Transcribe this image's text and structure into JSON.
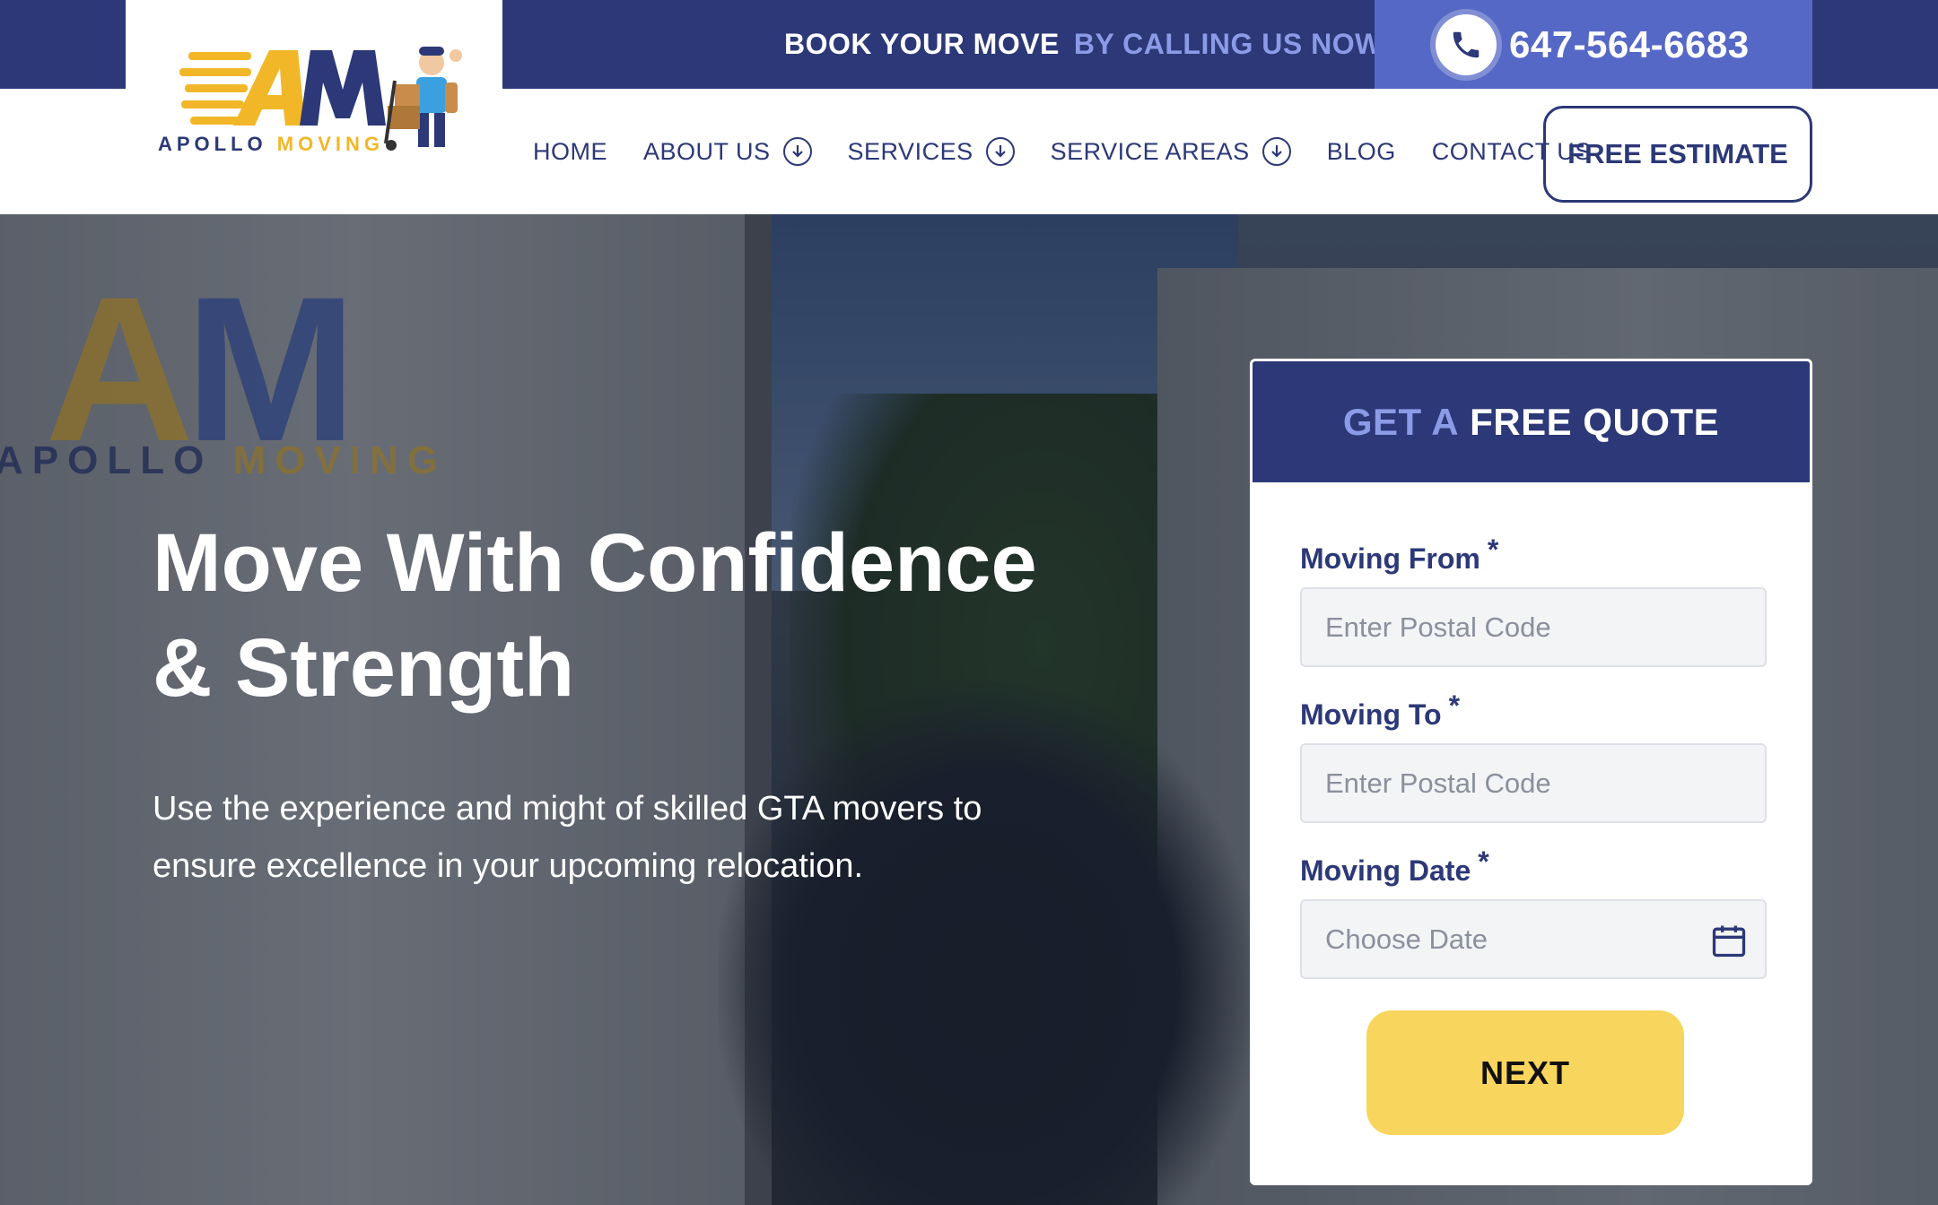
{
  "topbar": {
    "book_label": "BOOK YOUR MOVE",
    "call_label": "BY CALLING US NOW",
    "phone": "647-564-6683"
  },
  "logo": {
    "letters_a": "A",
    "letters_m": "M",
    "word_a": "APOLLO ",
    "word_b": "MOVING"
  },
  "nav": {
    "items": [
      {
        "label": "HOME",
        "dropdown": false
      },
      {
        "label": "ABOUT US",
        "dropdown": true
      },
      {
        "label": "SERVICES",
        "dropdown": true
      },
      {
        "label": "SERVICE AREAS",
        "dropdown": true
      },
      {
        "label": "BLOG",
        "dropdown": false
      },
      {
        "label": "CONTACT US",
        "dropdown": false
      }
    ],
    "cta": "FREE ESTIMATE"
  },
  "hero": {
    "headline_line1": "Move With Confidence",
    "headline_line2": "& Strength",
    "subtext": "Use the experience and might of skilled GTA movers to ensure excellence in your upcoming relocation."
  },
  "quote": {
    "title_a": "GET A",
    "title_b": "FREE QUOTE",
    "from_label": "Moving From",
    "from_placeholder": "Enter Postal Code",
    "to_label": "Moving To",
    "to_placeholder": "Enter Postal Code",
    "date_label": "Moving Date",
    "date_placeholder": "Choose Date",
    "required_mark": "*",
    "next": "NEXT"
  },
  "colors": {
    "navy": "#2c3877",
    "accent_blue": "#5668c6",
    "light_blue": "#8b9be6",
    "yellow": "#f8d55c",
    "gold": "#f2b728"
  }
}
